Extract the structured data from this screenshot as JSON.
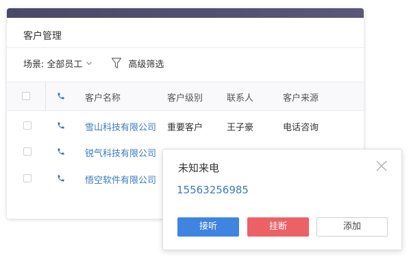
{
  "card": {
    "title": "客户管理",
    "filter": {
      "scene_label": "场景:",
      "scene_value": "全部员工",
      "advanced_label": "高级筛选"
    },
    "table": {
      "columns": [
        "客户名称",
        "客户级别",
        "联系人",
        "客户来源"
      ],
      "rows": [
        {
          "name": "雪山科技有限公司",
          "level": "重要客户",
          "contact": "王子豪",
          "source": "电话咨询"
        },
        {
          "name": "锐气科技有限公司",
          "level": "",
          "contact": "",
          "source": ""
        },
        {
          "name": "悟空软件有限公司",
          "level": "",
          "contact": "",
          "source": ""
        }
      ]
    }
  },
  "popup": {
    "title": "未知来电",
    "phone_number": "15563256985",
    "buttons": {
      "answer": "接听",
      "hangup": "挂断",
      "add": "添加"
    }
  },
  "colors": {
    "accent_blue": "#3e84e0",
    "link_blue": "#3a78c4",
    "hangup_red": "#ec6166",
    "header_bar": "#4a4968"
  },
  "icons": [
    "chevron-down-icon",
    "filter-icon",
    "phone-icon",
    "close-icon"
  ]
}
